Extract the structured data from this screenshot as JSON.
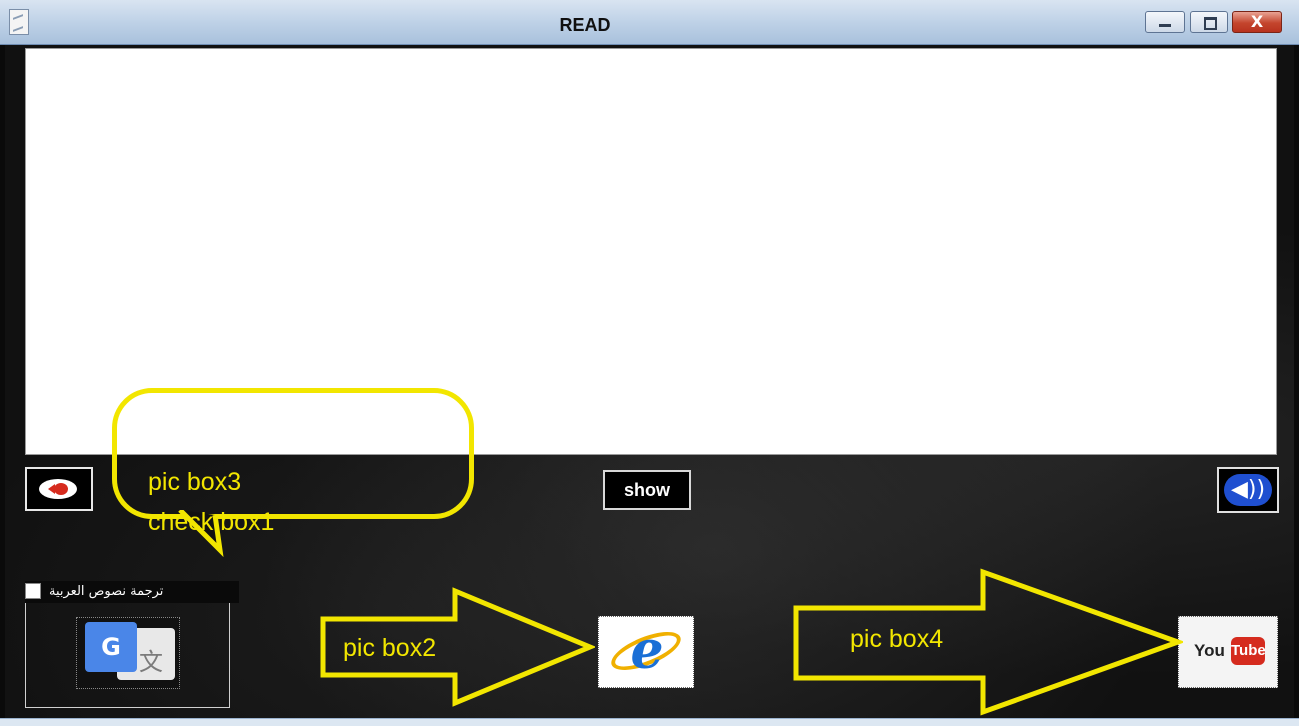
{
  "window": {
    "title": "READ",
    "controls": {
      "minimize": "–",
      "maximize": "□",
      "close": "X"
    }
  },
  "toolbar": {
    "show_label": "show",
    "back_icon": "red-arrow-back-icon",
    "speaker_icon": "speaker-icon",
    "speaker_glyph": "◀))"
  },
  "translate_group": {
    "checkbox_label": "ترجمة نصوص العربية",
    "checked": false,
    "icon": "google-translate-icon",
    "icon_front": "G",
    "icon_back": "文"
  },
  "pictures": {
    "ie_icon": "internet-explorer-icon",
    "ie_letter": "e",
    "youtube_icon": "youtube-icon",
    "youtube_you": "You",
    "youtube_tube": "Tube"
  },
  "annotations": {
    "callout_line1": "pic box3",
    "callout_line2": "check box1",
    "arrow1_label": "pic box2",
    "arrow2_label": "pic box4",
    "color": "#f2e600"
  },
  "colors": {
    "background": "#111111",
    "text_area": "#ffffff",
    "speaker": "#1f4fd0",
    "close_button": "#c4452d"
  }
}
